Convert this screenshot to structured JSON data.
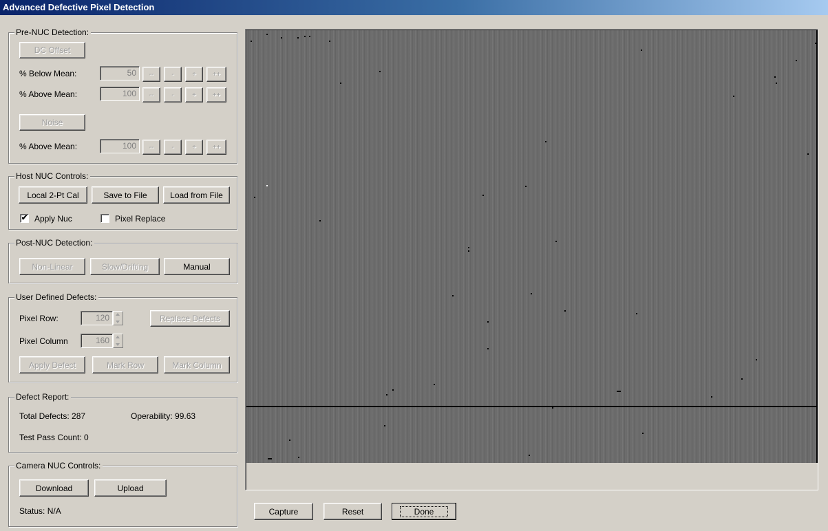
{
  "window": {
    "title": "Advanced Defective Pixel Detection"
  },
  "pre_nuc": {
    "title": "Pre-NUC Detection:",
    "dc_offset_button": "DC Offset",
    "below_mean_label": "% Below Mean:",
    "below_mean_value": "50",
    "above_mean_label": "% Above Mean:",
    "above_mean_value": "100",
    "noise_button": "Noise",
    "noise_above_mean_label": "% Above Mean:",
    "noise_above_mean_value": "100",
    "step_buttons": [
      "--",
      "-",
      "+",
      "++"
    ]
  },
  "host_nuc": {
    "title": "Host NUC Controls:",
    "local_cal_button": "Local 2-Pt Cal",
    "save_button": "Save to File",
    "load_button": "Load from File",
    "apply_nuc_label": "Apply Nuc",
    "apply_nuc_checked": true,
    "apply_nuc_mark": "✔",
    "pixel_replace_label": "Pixel Replace",
    "pixel_replace_checked": false
  },
  "post_nuc": {
    "title": "Post-NUC Detection:",
    "nonlinear_button": "Non-Linear",
    "slow_button": "Slow/Drifting",
    "manual_button": "Manual"
  },
  "user_defects": {
    "title": "User Defined Defects:",
    "row_label": "Pixel Row:",
    "row_value": "120",
    "col_label": "Pixel Column",
    "col_value": "160",
    "replace_button": "Replace Defects",
    "apply_button": "Apply Defect",
    "mark_row_button": "Mark Row",
    "mark_col_button": "Mark Column"
  },
  "defect_report": {
    "title": "Defect Report:",
    "total_label": "Total Defects: 287",
    "operability_label": "Operability: 99.63",
    "pass_count_label": "Test Pass Count: 0"
  },
  "camera_nuc": {
    "title": "Camera NUC Controls:",
    "download_button": "Download",
    "upload_button": "Upload",
    "status_label": "Status: N/A"
  },
  "bottom_buttons": {
    "capture": "Capture",
    "reset": "Reset",
    "done": "Done"
  },
  "colors": {
    "title_start": "#0a246a",
    "title_end": "#a6caf0",
    "face": "#d4d0c8",
    "image_gray": "#6c6c6c"
  }
}
